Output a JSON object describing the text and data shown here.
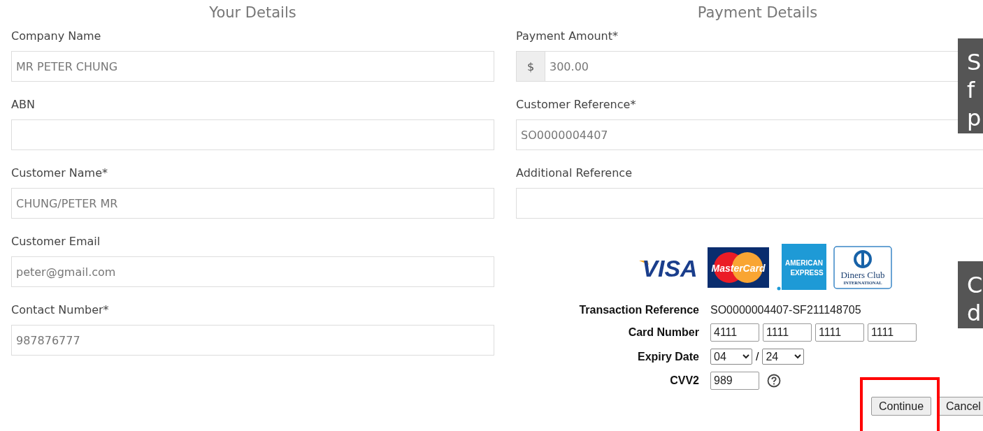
{
  "your_details": {
    "title": "Your Details",
    "fields": [
      {
        "label": "Company Name",
        "value": "MR PETER CHUNG"
      },
      {
        "label": "ABN"
      },
      {
        "label": "Customer Name*",
        "value": "CHUNG/PETER MR"
      },
      {
        "label": "Customer Email",
        "value": "peter@gmail.com"
      },
      {
        "label": "Contact Number*",
        "value": "987876777"
      }
    ]
  },
  "payment_details": {
    "title": "Payment Details",
    "fields": [
      {
        "label": "Payment Amount*",
        "prefix": "$",
        "value": "300.00"
      },
      {
        "label": "Customer Reference*",
        "value": "SO0000004407"
      },
      {
        "label": "Additional Reference"
      }
    ]
  },
  "card_logos": [
    {
      "kind": "visa",
      "lines": [
        "VISA"
      ]
    },
    {
      "kind": "mastercard",
      "lines": [
        "MasterCard"
      ]
    },
    {
      "kind": "amex",
      "lines": [
        "AMERICAN",
        "EXPRESS"
      ]
    },
    {
      "kind": "diners",
      "lines": [
        "Diners Club",
        "INTERNATIONAL"
      ]
    }
  ],
  "card_form": {
    "transaction_reference": {
      "label": "Transaction Reference",
      "value": "SO0000004407-SF211148705"
    },
    "card_number": {
      "label": "Card Number",
      "parts": [
        "4111",
        "1111",
        "1111",
        "1111"
      ]
    },
    "expiry": {
      "label": "Expiry Date",
      "month": "04",
      "separator": "/",
      "year": "24"
    },
    "cvv": {
      "label": "CVV2",
      "value": "989"
    }
  },
  "buttons": [
    {
      "label": "Continue",
      "highlighted": true
    },
    {
      "label": "Cancel",
      "highlighted": false
    }
  ],
  "callouts": [
    {
      "lines": [
        "S",
        "f",
        "p"
      ]
    },
    {
      "lines": [
        "C",
        "d"
      ]
    }
  ]
}
